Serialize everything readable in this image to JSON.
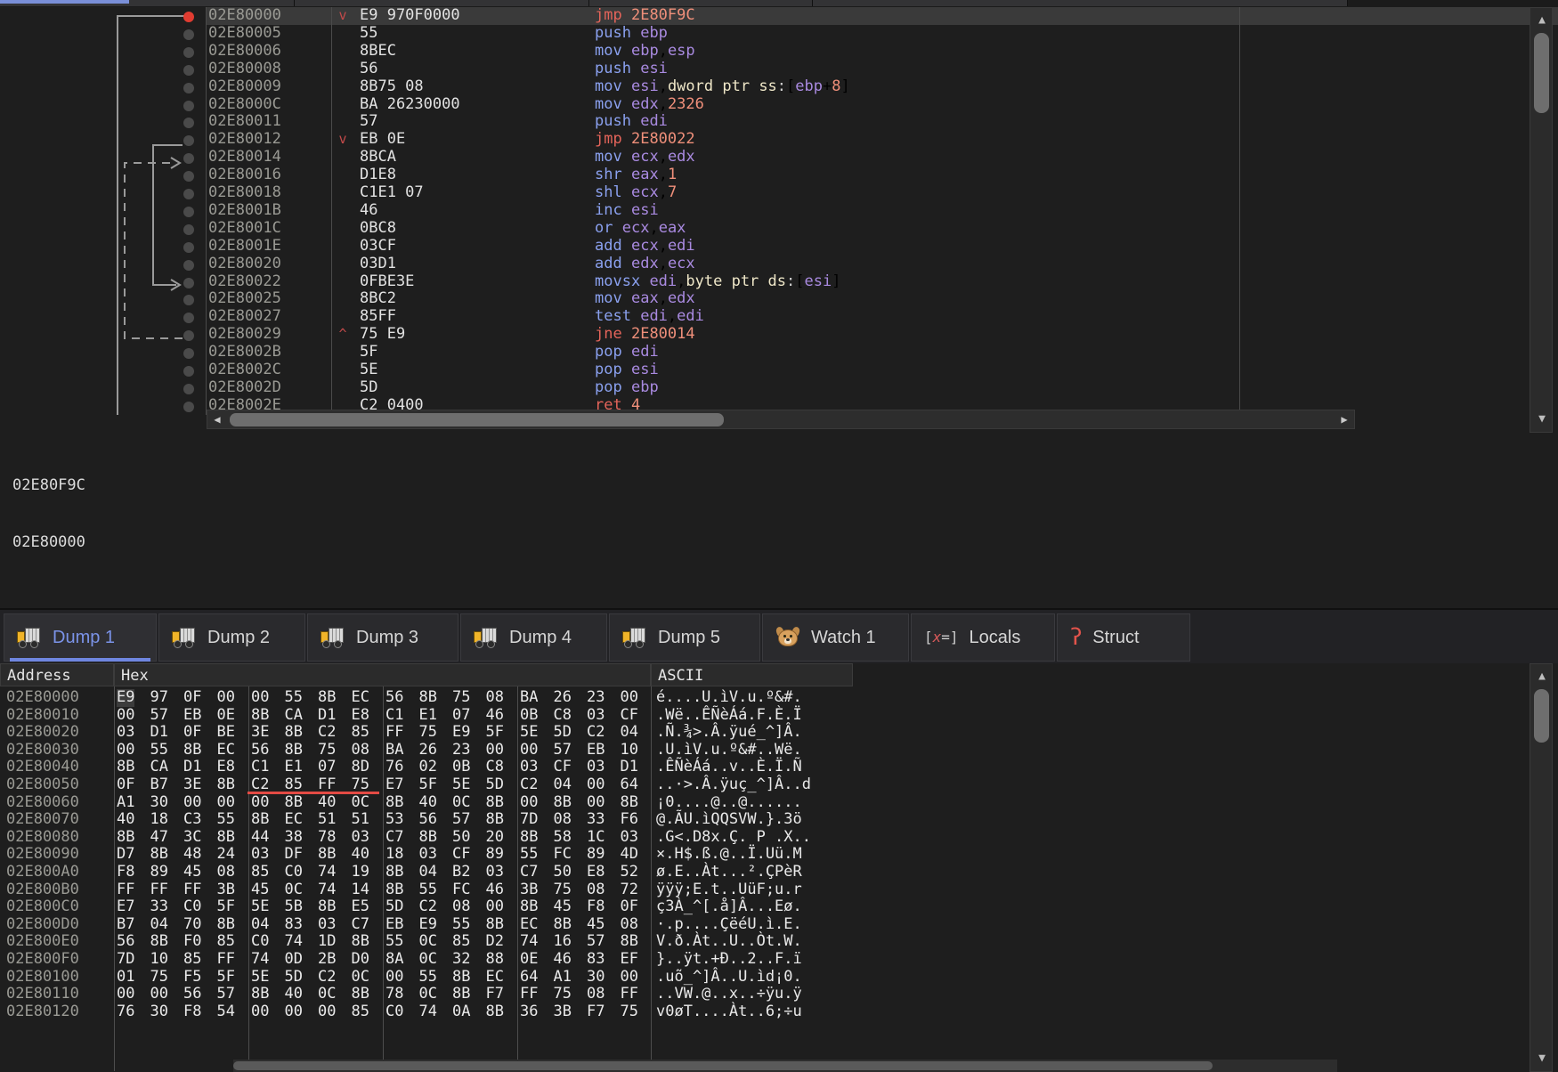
{
  "window": {
    "theme_bg": "#1e1e1e",
    "accent": "#7b93e8",
    "breakpoint_color": "#e03c31",
    "highlight_color": "#e44b44"
  },
  "disassembly": {
    "selected_address": "02E80000",
    "rows": [
      {
        "address": "02E80000",
        "arrow": "v",
        "bytes": "E9 970F0000",
        "mnemonic": "jmp",
        "mnemonic_kind": "jump",
        "operands": "2E80F9C",
        "selected": true,
        "breakpoint": true
      },
      {
        "address": "02E80005",
        "arrow": "",
        "bytes": "55",
        "mnemonic": "push",
        "mnemonic_kind": "norm",
        "operands": "ebp",
        "selected": false,
        "breakpoint": false
      },
      {
        "address": "02E80006",
        "arrow": "",
        "bytes": "8BEC",
        "mnemonic": "mov",
        "mnemonic_kind": "norm",
        "operands": "ebp,esp",
        "selected": false,
        "breakpoint": false
      },
      {
        "address": "02E80008",
        "arrow": "",
        "bytes": "56",
        "mnemonic": "push",
        "mnemonic_kind": "norm",
        "operands": "esi",
        "selected": false,
        "breakpoint": false
      },
      {
        "address": "02E80009",
        "arrow": "",
        "bytes": "8B75 08",
        "mnemonic": "mov",
        "mnemonic_kind": "norm",
        "operands": "esi,dword ptr ss:[ebp+8]",
        "selected": false,
        "breakpoint": false
      },
      {
        "address": "02E8000C",
        "arrow": "",
        "bytes": "BA 26230000",
        "mnemonic": "mov",
        "mnemonic_kind": "norm",
        "operands": "edx,2326",
        "selected": false,
        "breakpoint": false
      },
      {
        "address": "02E80011",
        "arrow": "",
        "bytes": "57",
        "mnemonic": "push",
        "mnemonic_kind": "norm",
        "operands": "edi",
        "selected": false,
        "breakpoint": false
      },
      {
        "address": "02E80012",
        "arrow": "v",
        "bytes": "EB 0E",
        "mnemonic": "jmp",
        "mnemonic_kind": "jump",
        "operands": "2E80022",
        "selected": false,
        "breakpoint": false
      },
      {
        "address": "02E80014",
        "arrow": "",
        "bytes": "8BCA",
        "mnemonic": "mov",
        "mnemonic_kind": "norm",
        "operands": "ecx,edx",
        "selected": false,
        "breakpoint": false
      },
      {
        "address": "02E80016",
        "arrow": "",
        "bytes": "D1E8",
        "mnemonic": "shr",
        "mnemonic_kind": "norm",
        "operands": "eax,1",
        "selected": false,
        "breakpoint": false
      },
      {
        "address": "02E80018",
        "arrow": "",
        "bytes": "C1E1 07",
        "mnemonic": "shl",
        "mnemonic_kind": "norm",
        "operands": "ecx,7",
        "selected": false,
        "breakpoint": false
      },
      {
        "address": "02E8001B",
        "arrow": "",
        "bytes": "46",
        "mnemonic": "inc",
        "mnemonic_kind": "norm",
        "operands": "esi",
        "selected": false,
        "breakpoint": false
      },
      {
        "address": "02E8001C",
        "arrow": "",
        "bytes": "0BC8",
        "mnemonic": "or",
        "mnemonic_kind": "norm",
        "operands": "ecx,eax",
        "selected": false,
        "breakpoint": false
      },
      {
        "address": "02E8001E",
        "arrow": "",
        "bytes": "03CF",
        "mnemonic": "add",
        "mnemonic_kind": "norm",
        "operands": "ecx,edi",
        "selected": false,
        "breakpoint": false
      },
      {
        "address": "02E80020",
        "arrow": "",
        "bytes": "03D1",
        "mnemonic": "add",
        "mnemonic_kind": "norm",
        "operands": "edx,ecx",
        "selected": false,
        "breakpoint": false
      },
      {
        "address": "02E80022",
        "arrow": "",
        "bytes": "0FBE3E",
        "mnemonic": "movsx",
        "mnemonic_kind": "norm",
        "operands": "edi,byte ptr ds:[esi]",
        "selected": false,
        "breakpoint": false
      },
      {
        "address": "02E80025",
        "arrow": "",
        "bytes": "8BC2",
        "mnemonic": "mov",
        "mnemonic_kind": "norm",
        "operands": "eax,edx",
        "selected": false,
        "breakpoint": false
      },
      {
        "address": "02E80027",
        "arrow": "",
        "bytes": "85FF",
        "mnemonic": "test",
        "mnemonic_kind": "norm",
        "operands": "edi,edi",
        "selected": false,
        "breakpoint": false
      },
      {
        "address": "02E80029",
        "arrow": "^",
        "bytes": "75 E9",
        "mnemonic": "jne",
        "mnemonic_kind": "jump",
        "operands": "2E80014",
        "selected": false,
        "breakpoint": false
      },
      {
        "address": "02E8002B",
        "arrow": "",
        "bytes": "5F",
        "mnemonic": "pop",
        "mnemonic_kind": "norm",
        "operands": "edi",
        "selected": false,
        "breakpoint": false
      },
      {
        "address": "02E8002C",
        "arrow": "",
        "bytes": "5E",
        "mnemonic": "pop",
        "mnemonic_kind": "norm",
        "operands": "esi",
        "selected": false,
        "breakpoint": false
      },
      {
        "address": "02E8002D",
        "arrow": "",
        "bytes": "5D",
        "mnemonic": "pop",
        "mnemonic_kind": "norm",
        "operands": "ebp",
        "selected": false,
        "breakpoint": false
      },
      {
        "address": "02E8002E",
        "arrow": "",
        "bytes": "C2 0400",
        "mnemonic": "ret",
        "mnemonic_kind": "jump",
        "operands": "4",
        "selected": false,
        "breakpoint": false
      }
    ]
  },
  "info_pane": {
    "line1": "02E80F9C",
    "line2": "02E80000"
  },
  "dump_tabs": [
    {
      "label": "Dump 1",
      "icon": "dump-truck-icon",
      "active": true
    },
    {
      "label": "Dump 2",
      "icon": "dump-truck-icon",
      "active": false
    },
    {
      "label": "Dump 3",
      "icon": "dump-truck-icon",
      "active": false
    },
    {
      "label": "Dump 4",
      "icon": "dump-truck-icon",
      "active": false
    },
    {
      "label": "Dump 5",
      "icon": "dump-truck-icon",
      "active": false
    },
    {
      "label": "Watch 1",
      "icon": "dog-icon",
      "active": false
    },
    {
      "label": "Locals",
      "icon": "variable-icon",
      "active": false
    },
    {
      "label": "Struct",
      "icon": "candy-cane-icon",
      "active": false
    }
  ],
  "dump": {
    "columns": {
      "address": "Address",
      "hex": "Hex",
      "ascii": "ASCII"
    },
    "highlight": {
      "row_index": 5,
      "group_index": 1,
      "note": "red underline under C2 85 FF 75"
    },
    "rows": [
      {
        "address": "02E80000",
        "groups": [
          [
            "E9",
            "97",
            "0F",
            "00"
          ],
          [
            "00",
            "55",
            "8B",
            "EC"
          ],
          [
            "56",
            "8B",
            "75",
            "08"
          ],
          [
            "BA",
            "26",
            "23",
            "00"
          ]
        ],
        "ascii": "é....U.ìV.u.º&#."
      },
      {
        "address": "02E80010",
        "groups": [
          [
            "00",
            "57",
            "EB",
            "0E"
          ],
          [
            "8B",
            "CA",
            "D1",
            "E8"
          ],
          [
            "C1",
            "E1",
            "07",
            "46"
          ],
          [
            "0B",
            "C8",
            "03",
            "CF"
          ]
        ],
        "ascii": ".Wë..ÊÑèÁá.F.È.Ï"
      },
      {
        "address": "02E80020",
        "groups": [
          [
            "03",
            "D1",
            "0F",
            "BE"
          ],
          [
            "3E",
            "8B",
            "C2",
            "85"
          ],
          [
            "FF",
            "75",
            "E9",
            "5F"
          ],
          [
            "5E",
            "5D",
            "C2",
            "04"
          ]
        ],
        "ascii": ".Ñ.¾>.Â.ÿué_^]Â."
      },
      {
        "address": "02E80030",
        "groups": [
          [
            "00",
            "55",
            "8B",
            "EC"
          ],
          [
            "56",
            "8B",
            "75",
            "08"
          ],
          [
            "BA",
            "26",
            "23",
            "00"
          ],
          [
            "00",
            "57",
            "EB",
            "10"
          ]
        ],
        "ascii": ".U.ìV.u.º&#..Wë."
      },
      {
        "address": "02E80040",
        "groups": [
          [
            "8B",
            "CA",
            "D1",
            "E8"
          ],
          [
            "C1",
            "E1",
            "07",
            "8D"
          ],
          [
            "76",
            "02",
            "0B",
            "C8"
          ],
          [
            "03",
            "CF",
            "03",
            "D1"
          ]
        ],
        "ascii": ".ÊÑèÁá..v..È.Ï.Ñ"
      },
      {
        "address": "02E80050",
        "groups": [
          [
            "0F",
            "B7",
            "3E",
            "8B"
          ],
          [
            "C2",
            "85",
            "FF",
            "75"
          ],
          [
            "E7",
            "5F",
            "5E",
            "5D"
          ],
          [
            "C2",
            "04",
            "00",
            "64"
          ]
        ],
        "ascii": "..·>.Â.ÿuç_^]Â..d"
      },
      {
        "address": "02E80060",
        "groups": [
          [
            "A1",
            "30",
            "00",
            "00"
          ],
          [
            "00",
            "8B",
            "40",
            "0C"
          ],
          [
            "8B",
            "40",
            "0C",
            "8B"
          ],
          [
            "00",
            "8B",
            "00",
            "8B"
          ]
        ],
        "ascii": "¡0....@..@......"
      },
      {
        "address": "02E80070",
        "groups": [
          [
            "40",
            "18",
            "C3",
            "55"
          ],
          [
            "8B",
            "EC",
            "51",
            "51"
          ],
          [
            "53",
            "56",
            "57",
            "8B"
          ],
          [
            "7D",
            "08",
            "33",
            "F6"
          ]
        ],
        "ascii": "@.ÃU.ìQQSVW.}.3ö"
      },
      {
        "address": "02E80080",
        "groups": [
          [
            "8B",
            "47",
            "3C",
            "8B"
          ],
          [
            "44",
            "38",
            "78",
            "03"
          ],
          [
            "C7",
            "8B",
            "50",
            "20"
          ],
          [
            "8B",
            "58",
            "1C",
            "03"
          ]
        ],
        "ascii": ".G<.D8x.Ç. P .X.."
      },
      {
        "address": "02E80090",
        "groups": [
          [
            "D7",
            "8B",
            "48",
            "24"
          ],
          [
            "03",
            "DF",
            "8B",
            "40"
          ],
          [
            "18",
            "03",
            "CF",
            "89"
          ],
          [
            "55",
            "FC",
            "89",
            "4D"
          ]
        ],
        "ascii": "×.H$.ß.@..Ï.Uü.M"
      },
      {
        "address": "02E800A0",
        "groups": [
          [
            "F8",
            "89",
            "45",
            "08"
          ],
          [
            "85",
            "C0",
            "74",
            "19"
          ],
          [
            "8B",
            "04",
            "B2",
            "03"
          ],
          [
            "C7",
            "50",
            "E8",
            "52"
          ]
        ],
        "ascii": "ø.E..Àt...².ÇPèR"
      },
      {
        "address": "02E800B0",
        "groups": [
          [
            "FF",
            "FF",
            "FF",
            "3B"
          ],
          [
            "45",
            "0C",
            "74",
            "14"
          ],
          [
            "8B",
            "55",
            "FC",
            "46"
          ],
          [
            "3B",
            "75",
            "08",
            "72"
          ]
        ],
        "ascii": "ÿÿÿ;E.t..UüF;u.r"
      },
      {
        "address": "02E800C0",
        "groups": [
          [
            "E7",
            "33",
            "C0",
            "5F"
          ],
          [
            "5E",
            "5B",
            "8B",
            "E5"
          ],
          [
            "5D",
            "C2",
            "08",
            "00"
          ],
          [
            "8B",
            "45",
            "F8",
            "0F"
          ]
        ],
        "ascii": "ç3À_^[.å]Â...Eø."
      },
      {
        "address": "02E800D0",
        "groups": [
          [
            "B7",
            "04",
            "70",
            "8B"
          ],
          [
            "04",
            "83",
            "03",
            "C7"
          ],
          [
            "EB",
            "E9",
            "55",
            "8B"
          ],
          [
            "EC",
            "8B",
            "45",
            "08"
          ]
        ],
        "ascii": "·.p....ÇëéU.ì.E."
      },
      {
        "address": "02E800E0",
        "groups": [
          [
            "56",
            "8B",
            "F0",
            "85"
          ],
          [
            "C0",
            "74",
            "1D",
            "8B"
          ],
          [
            "55",
            "0C",
            "85",
            "D2"
          ],
          [
            "74",
            "16",
            "57",
            "8B"
          ]
        ],
        "ascii": "V.ð.Àt..U..Òt.W."
      },
      {
        "address": "02E800F0",
        "groups": [
          [
            "7D",
            "10",
            "85",
            "FF"
          ],
          [
            "74",
            "0D",
            "2B",
            "D0"
          ],
          [
            "8A",
            "0C",
            "32",
            "88"
          ],
          [
            "0E",
            "46",
            "83",
            "EF"
          ]
        ],
        "ascii": "}..ÿt.+Ð..2..F.ï"
      },
      {
        "address": "02E80100",
        "groups": [
          [
            "01",
            "75",
            "F5",
            "5F"
          ],
          [
            "5E",
            "5D",
            "C2",
            "0C"
          ],
          [
            "00",
            "55",
            "8B",
            "EC"
          ],
          [
            "64",
            "A1",
            "30",
            "00"
          ]
        ],
        "ascii": ".uõ_^]Â..U.ìd¡0."
      },
      {
        "address": "02E80110",
        "groups": [
          [
            "00",
            "00",
            "56",
            "57"
          ],
          [
            "8B",
            "40",
            "0C",
            "8B"
          ],
          [
            "78",
            "0C",
            "8B",
            "F7"
          ],
          [
            "FF",
            "75",
            "08",
            "FF"
          ]
        ],
        "ascii": "..VW.@..x..÷ÿu.ÿ"
      },
      {
        "address": "02E80120",
        "groups": [
          [
            "76",
            "30",
            "F8",
            "54"
          ],
          [
            "00",
            "00",
            "00",
            "85"
          ],
          [
            "C0",
            "74",
            "0A",
            "8B"
          ],
          [
            "36",
            "3B",
            "F7",
            "75"
          ]
        ],
        "ascii": "v0øT....Àt..6;÷u"
      }
    ]
  },
  "scrollbars": {
    "disasm_vertical": {
      "arrow_up": "▲",
      "arrow_down": "▼"
    },
    "disasm_horizontal": {
      "arrow_left": "◀",
      "arrow_right": "▶"
    },
    "dump_vertical": {
      "arrow_up": "▲",
      "arrow_down": "▼"
    }
  }
}
